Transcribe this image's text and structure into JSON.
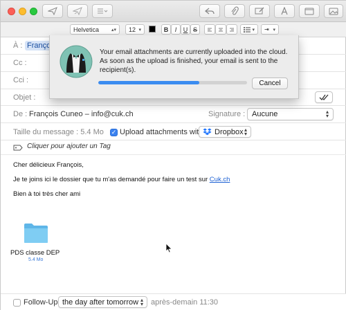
{
  "format_bar": {
    "font": "Helvetica",
    "size": "12",
    "text_color": "#000000",
    "bold": "B",
    "italic": "I",
    "underline": "U",
    "strike": "S"
  },
  "header": {
    "to_label": "À :",
    "to_value": "François",
    "cc_label": "Cc :",
    "bcc_label": "Cci :",
    "subject_label": "Objet :",
    "from_label": "De :",
    "from_value": "François Cuneo – info@cuk.ch",
    "signature_label": "Signature :",
    "signature_value": "Aucune",
    "size_label": "Taille du message : 5.4 Mo",
    "upload_label": "Upload attachments with",
    "upload_checked": true,
    "upload_service": "Dropbox",
    "tag_label": "Cliquer pour ajouter un Tag"
  },
  "body": {
    "line1": "Cher délicieux François,",
    "line2_prefix": "Je te joins ici le dossier que tu m'as demandé pour faire un test sur ",
    "line2_link": "Cuk.ch",
    "line3": "Bien à toi très cher ami",
    "attachment_name": "PDS classe DEP",
    "attachment_size": "5.4 Mo"
  },
  "footer": {
    "followup_label": "Follow-Up",
    "followup_checked": false,
    "followup_option": "the day after tomorrow",
    "followup_date": "après-demain 11:30"
  },
  "dialog": {
    "message": "Your email attachments are currently uploaded into the cloud. As soon as the upload is finished, your email is sent to the recipient(s).",
    "progress": 0.68,
    "cancel_label": "Cancel"
  },
  "colors": {
    "accent": "#3b82f0",
    "chip_bg": "#d6e3f7",
    "folder": "#6fc3ef"
  }
}
